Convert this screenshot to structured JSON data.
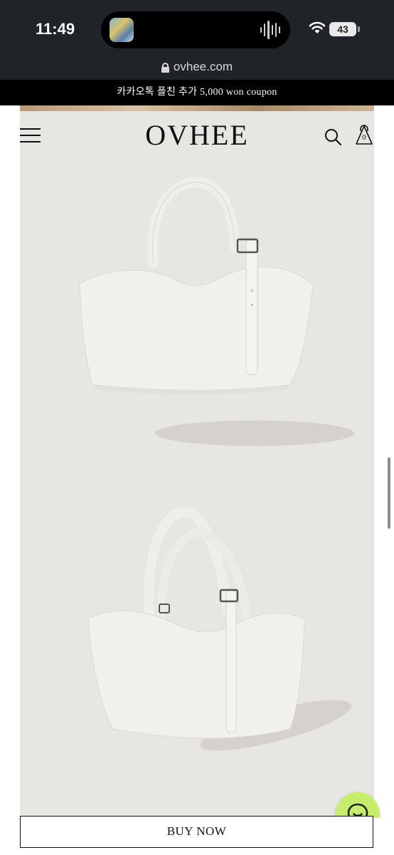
{
  "status_bar": {
    "time": "11:49",
    "battery": "43"
  },
  "browser": {
    "url": "ovhee.com"
  },
  "announcement": {
    "text": "카카오톡 플친 추가 5,000 won coupon"
  },
  "header": {
    "logo": "OVHEE",
    "cart_count": "0"
  },
  "products": {
    "images": [
      {
        "icon": "white-tote-bag-front"
      },
      {
        "icon": "white-tote-bag-angle"
      }
    ]
  },
  "actions": {
    "buy_now": "BUY NOW"
  },
  "colors": {
    "status_bg": "#202327",
    "announce_bg": "#000000",
    "page_bg": "#e8e6e3",
    "chat_bg": "#c6ed6c"
  }
}
